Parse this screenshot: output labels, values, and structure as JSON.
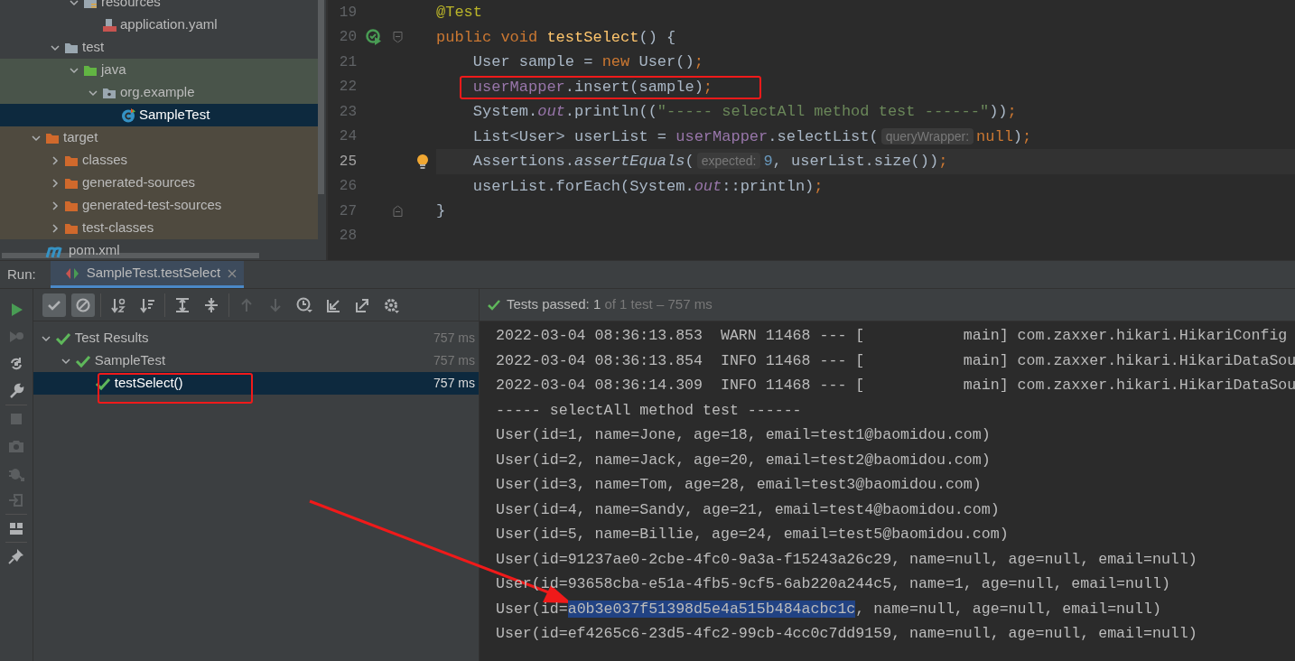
{
  "project_tree": {
    "items": [
      {
        "children": [
          {
            "children": [
              {
                "label": "resources",
                "kind": "folder-resources",
                "expanded": true,
                "selected": false,
                "children": [
                  {
                    "label": "application.yaml",
                    "kind": "yaml",
                    "selected": false
                  }
                ]
              }
            ]
          },
          {
            "label": "test",
            "kind": "folder",
            "expanded": true,
            "selected": false,
            "children": [
              {
                "label": "java",
                "kind": "folder-test",
                "expanded": true,
                "selected": false,
                "children": [
                  {
                    "label": "org.example",
                    "kind": "package",
                    "expanded": true,
                    "selected": false,
                    "children": [
                      {
                        "label": "SampleTest",
                        "kind": "test-class",
                        "selected": true
                      }
                    ]
                  }
                ]
              }
            ]
          }
        ]
      },
      {
        "label": "target",
        "kind": "folder-excluded",
        "expanded": true,
        "selected": false,
        "children": [
          {
            "label": "classes",
            "kind": "folder-excluded",
            "expanded": false,
            "selected": false
          },
          {
            "label": "generated-sources",
            "kind": "folder-excluded",
            "expanded": false,
            "selected": false
          },
          {
            "label": "generated-test-sources",
            "kind": "folder-excluded",
            "expanded": false,
            "selected": false
          },
          {
            "label": "test-classes",
            "kind": "folder-excluded",
            "expanded": false,
            "selected": false
          }
        ]
      },
      {
        "label": "pom.xml",
        "kind": "maven",
        "selected": false
      }
    ]
  },
  "editor": {
    "lines": [
      {
        "number": "19",
        "kind": "code",
        "current": false,
        "marked": false,
        "tokens": [
          {
            "kind": "annotation",
            "text": "@Test"
          }
        ]
      },
      {
        "number": "20",
        "kind": "test-method",
        "current": false,
        "marked": false,
        "tokens": [
          {
            "kind": "keyword",
            "text": "public void "
          },
          {
            "kind": "declaration",
            "text": "testSelect"
          },
          {
            "kind": "plain",
            "text": "() {"
          }
        ]
      },
      {
        "number": "21",
        "kind": "code",
        "current": false,
        "marked": false,
        "tokens": [
          {
            "kind": "plain",
            "text": "    User sample = "
          },
          {
            "kind": "keyword",
            "text": "new "
          },
          {
            "kind": "plain",
            "text": "User()"
          },
          {
            "kind": "keyword",
            "text": ";"
          }
        ]
      },
      {
        "number": "22",
        "kind": "code",
        "current": false,
        "marked": true,
        "tokens": [
          {
            "kind": "field",
            "text": "    userMapper"
          },
          {
            "kind": "plain",
            "text": ".insert(sample)"
          },
          {
            "kind": "keyword",
            "text": ";"
          }
        ]
      },
      {
        "number": "23",
        "kind": "code",
        "current": false,
        "marked": false,
        "tokens": [
          {
            "kind": "plain",
            "text": "    System."
          },
          {
            "kind": "static-field",
            "text": "out"
          },
          {
            "kind": "plain",
            "text": ".println(("
          },
          {
            "kind": "string",
            "text": "\"----- selectAll method test ------\""
          },
          {
            "kind": "plain",
            "text": "))"
          },
          {
            "kind": "keyword",
            "text": ";"
          }
        ]
      },
      {
        "number": "24",
        "kind": "code",
        "current": false,
        "marked": false,
        "tokens": [
          {
            "kind": "plain",
            "text": "    List<User> userList = "
          },
          {
            "kind": "field",
            "text": "userMapper"
          },
          {
            "kind": "plain",
            "text": ".selectList("
          },
          {
            "kind": "hint",
            "text": "queryWrapper:"
          },
          {
            "kind": "keyword",
            "text": "null"
          },
          {
            "kind": "plain",
            "text": ")"
          },
          {
            "kind": "keyword",
            "text": ";"
          }
        ]
      },
      {
        "number": "25",
        "kind": "intention",
        "current": true,
        "marked": false,
        "tokens": [
          {
            "kind": "plain",
            "text": "    Assertions."
          },
          {
            "kind": "static-method",
            "text": "assertEquals"
          },
          {
            "kind": "plain",
            "text": "("
          },
          {
            "kind": "hint",
            "text": "expected:"
          },
          {
            "kind": "number",
            "text": "9"
          },
          {
            "kind": "plain",
            "text": ", userList.size())"
          },
          {
            "kind": "keyword",
            "text": ";"
          }
        ]
      },
      {
        "number": "26",
        "kind": "code",
        "current": false,
        "marked": false,
        "tokens": [
          {
            "kind": "plain",
            "text": "    userList.forEach(System."
          },
          {
            "kind": "static-field",
            "text": "out"
          },
          {
            "kind": "plain",
            "text": "::println)"
          },
          {
            "kind": "keyword",
            "text": ";"
          }
        ]
      },
      {
        "number": "27",
        "kind": "block-end",
        "current": false,
        "marked": false,
        "tokens": [
          {
            "kind": "plain",
            "text": "}"
          }
        ]
      },
      {
        "number": "28",
        "kind": "code",
        "current": false
      }
    ]
  },
  "run_bar": {
    "label": "Run:",
    "tabs": [
      {
        "label": "SampleTest.testSelect",
        "selected": true
      }
    ]
  },
  "side_toolbar": [
    [
      {
        "kind": "run",
        "disabled": false
      },
      {
        "kind": "rerun-failed",
        "disabled": true
      },
      {
        "kind": "toggle-auto",
        "disabled": false
      },
      {
        "kind": "wrench",
        "disabled": false
      }
    ],
    [
      {
        "kind": "stop",
        "disabled": true
      },
      {
        "kind": "camera",
        "disabled": true
      },
      {
        "kind": "debug",
        "disabled": true
      },
      {
        "kind": "exit",
        "disabled": true
      }
    ],
    [
      {
        "kind": "layout",
        "disabled": false
      }
    ],
    [
      {
        "kind": "pin",
        "disabled": false
      }
    ]
  ],
  "test_toolbar": [
    [
      {
        "kind": "check",
        "on": true,
        "disabled": false
      },
      {
        "kind": "ignored",
        "on": true,
        "disabled": false
      }
    ],
    [
      {
        "kind": "sort-alpha",
        "on": false,
        "disabled": false
      },
      {
        "kind": "sort-duration",
        "on": false,
        "disabled": false
      }
    ],
    [
      {
        "kind": "expand",
        "on": false,
        "disabled": false
      },
      {
        "kind": "collapse",
        "on": false,
        "disabled": false
      }
    ],
    [
      {
        "kind": "up",
        "on": false,
        "disabled": true
      },
      {
        "kind": "down",
        "on": false,
        "disabled": true
      },
      {
        "kind": "history",
        "on": false,
        "disabled": false
      },
      {
        "kind": "import",
        "on": false,
        "disabled": false
      },
      {
        "kind": "export",
        "on": false,
        "disabled": false
      },
      {
        "kind": "settings",
        "on": false,
        "disabled": false
      }
    ]
  ],
  "test_tree": {
    "items": [
      {
        "label": "Test Results",
        "time": "757 ms",
        "expanded": true,
        "selected": false,
        "marked": false,
        "children": [
          {
            "label": "SampleTest",
            "time": "757 ms",
            "expanded": true,
            "selected": false,
            "marked": false,
            "children": [
              {
                "label": "testSelect()",
                "time": "757 ms",
                "selected": true,
                "marked": true
              }
            ]
          }
        ]
      }
    ]
  },
  "status": {
    "passed": "Tests passed: 1",
    "detail": "of 1 test – 757 ms"
  },
  "console": {
    "lines": [
      {
        "segments": [
          {
            "text": "2022-03-04 08:36:13.853  WARN 11468 --- [           main] com.zaxxer.hikari.HikariConfig",
            "selected": false
          }
        ]
      },
      {
        "segments": [
          {
            "text": "2022-03-04 08:36:13.854  INFO 11468 --- [           main] com.zaxxer.hikari.HikariDataSou",
            "selected": false
          }
        ]
      },
      {
        "segments": [
          {
            "text": "2022-03-04 08:36:14.309  INFO 11468 --- [           main] com.zaxxer.hikari.HikariDataSou",
            "selected": false
          }
        ]
      },
      {
        "segments": [
          {
            "text": "----- selectAll method test ------",
            "selected": false
          }
        ]
      },
      {
        "segments": [
          {
            "text": "User(id=1, name=Jone, age=18, email=test1@baomidou.com)",
            "selected": false
          }
        ]
      },
      {
        "segments": [
          {
            "text": "User(id=2, name=Jack, age=20, email=test2@baomidou.com)",
            "selected": false
          }
        ]
      },
      {
        "segments": [
          {
            "text": "User(id=3, name=Tom, age=28, email=test3@baomidou.com)",
            "selected": false
          }
        ]
      },
      {
        "segments": [
          {
            "text": "User(id=4, name=Sandy, age=21, email=test4@baomidou.com)",
            "selected": false
          }
        ]
      },
      {
        "segments": [
          {
            "text": "User(id=5, name=Billie, age=24, email=test5@baomidou.com)",
            "selected": false
          }
        ]
      },
      {
        "segments": [
          {
            "text": "User(id=91237ae0-2cbe-4fc0-9a3a-f15243a26c29, name=null, age=null, email=null)",
            "selected": false
          }
        ]
      },
      {
        "segments": [
          {
            "text": "User(id=93658cba-e51a-4fb5-9cf5-6ab220a244c5, name=1, age=null, email=null)",
            "selected": false
          }
        ]
      },
      {
        "arrow": true,
        "segments": [
          {
            "text": "User(id=",
            "selected": false
          },
          {
            "text": "a0b3e037f51398d5e4a515b484acbc1c",
            "selected": true
          },
          {
            "text": ", name=null, age=null, email=null)",
            "selected": false
          }
        ]
      },
      {
        "segments": [
          {
            "text": "User(id=ef4265c6-23d5-4fc2-99cb-4cc0c7dd9159, name=null, age=null, email=null)",
            "selected": false
          }
        ]
      }
    ]
  }
}
